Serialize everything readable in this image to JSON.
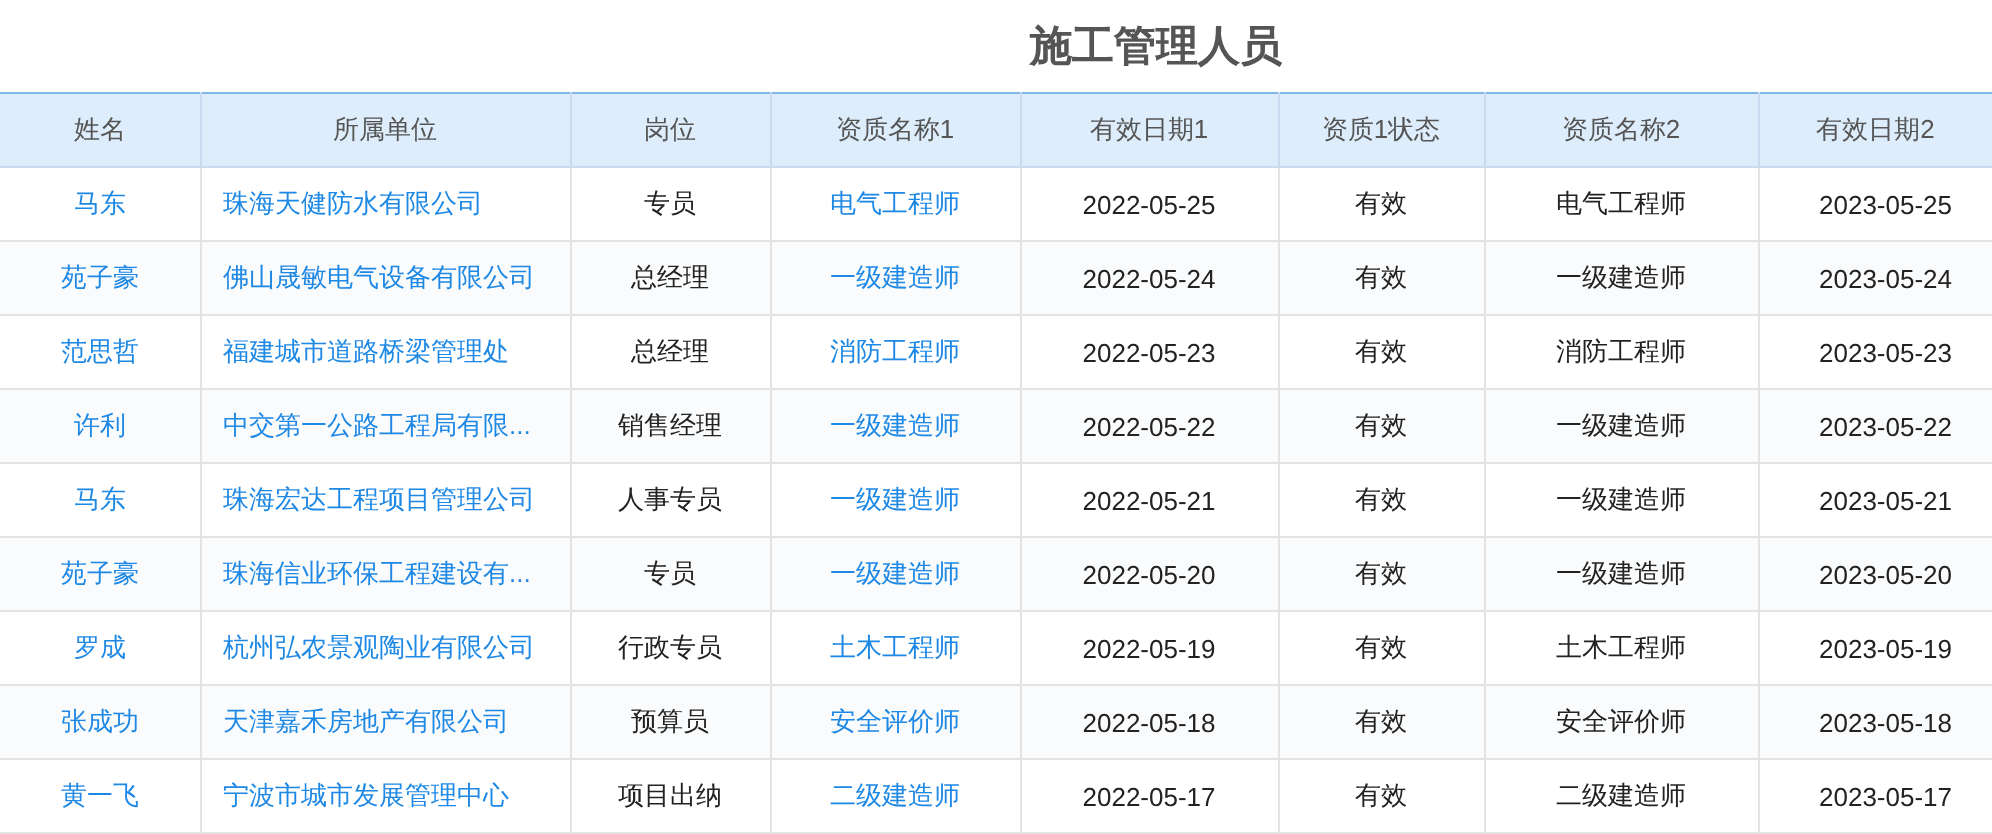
{
  "title": "施工管理人员",
  "table": {
    "columns": [
      {
        "label": "姓名",
        "kind": "link"
      },
      {
        "label": "所属单位",
        "kind": "link"
      },
      {
        "label": "岗位",
        "kind": "text"
      },
      {
        "label": "资质名称1",
        "kind": "link"
      },
      {
        "label": "有效日期1",
        "kind": "text"
      },
      {
        "label": "资质1状态",
        "kind": "text"
      },
      {
        "label": "资质名称2",
        "kind": "text"
      },
      {
        "label": "有效日期2",
        "kind": "text"
      }
    ],
    "rows": [
      [
        "马东",
        "珠海天健防水有限公司",
        "专员",
        "电气工程师",
        "2022-05-25",
        "有效",
        "电气工程师",
        "2023-05-25"
      ],
      [
        "苑子豪",
        "佛山晟敏电气设备有限公司",
        "总经理",
        "一级建造师",
        "2022-05-24",
        "有效",
        "一级建造师",
        "2023-05-24"
      ],
      [
        "范思哲",
        "福建城市道路桥梁管理处",
        "总经理",
        "消防工程师",
        "2022-05-23",
        "有效",
        "消防工程师",
        "2023-05-23"
      ],
      [
        "许利",
        "中交第一公路工程局有限...",
        "销售经理",
        "一级建造师",
        "2022-05-22",
        "有效",
        "一级建造师",
        "2023-05-22"
      ],
      [
        "马东",
        "珠海宏达工程项目管理公司",
        "人事专员",
        "一级建造师",
        "2022-05-21",
        "有效",
        "一级建造师",
        "2023-05-21"
      ],
      [
        "苑子豪",
        "珠海信业环保工程建设有...",
        "专员",
        "一级建造师",
        "2022-05-20",
        "有效",
        "一级建造师",
        "2023-05-20"
      ],
      [
        "罗成",
        "杭州弘农景观陶业有限公司",
        "行政专员",
        "土木工程师",
        "2022-05-19",
        "有效",
        "土木工程师",
        "2023-05-19"
      ],
      [
        "张成功",
        "天津嘉禾房地产有限公司",
        "预算员",
        "安全评价师",
        "2022-05-18",
        "有效",
        "安全评价师",
        "2023-05-18"
      ],
      [
        "黄一飞",
        "宁波市城市发展管理中心",
        "项目出纳",
        "二级建造师",
        "2022-05-17",
        "有效",
        "二级建造师",
        "2023-05-17"
      ]
    ]
  }
}
